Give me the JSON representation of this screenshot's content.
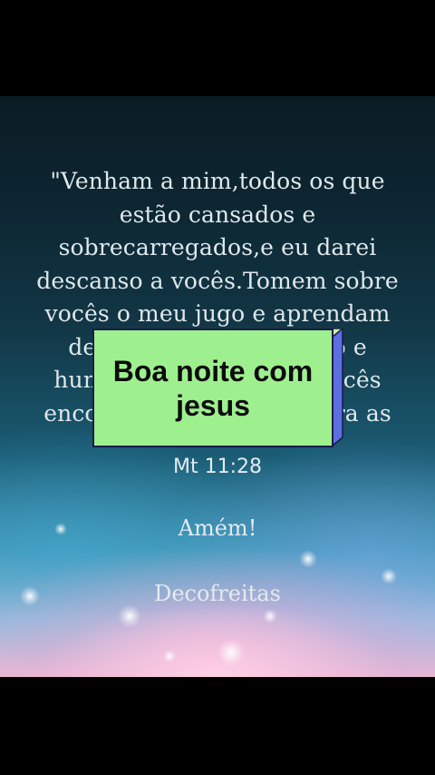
{
  "verse": {
    "lines": [
      "\"Venham a mim,todos os que",
      "estão cansados e",
      "sobrecarregados,e eu darei",
      "descanso a vocês.Tomem sobre",
      "vocês o meu jugo e aprendam",
      "de mim, pois sou manso e",
      "humilde de coração, e vocês",
      "encontrarão descanso para as"
    ]
  },
  "reference": "Mt 11:28",
  "amen": "Amém!",
  "author": "Decofreitas",
  "overlay": {
    "line1": "Boa noite com",
    "line2": "jesus",
    "bg_color": "#9ef08f",
    "side_color": "#5b6fe0"
  }
}
